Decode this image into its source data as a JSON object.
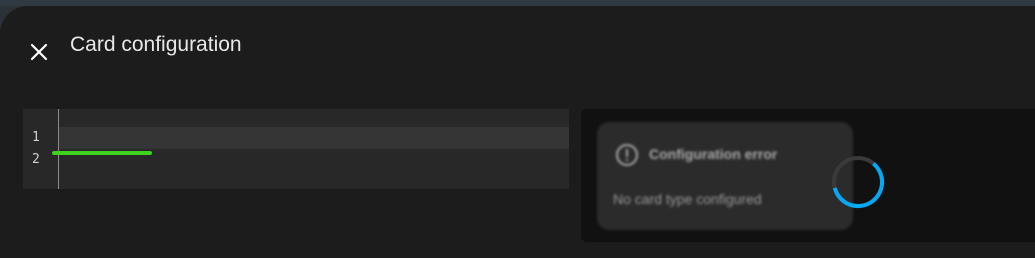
{
  "dialog": {
    "title": "Card configuration",
    "close_icon": "close-icon"
  },
  "editor": {
    "lines": [
      {
        "number": "1",
        "text": ""
      },
      {
        "number": "2",
        "text": ""
      }
    ]
  },
  "preview": {
    "error_card": {
      "icon": "alert-circle-icon",
      "title": "Configuration error",
      "message": "No card type configured"
    },
    "spinner": "loading-spinner"
  },
  "colors": {
    "dialog_bg": "#1c1c1c",
    "editor_bg": "#282828",
    "cursor_marker": "#3fd21e",
    "spinner_accent": "#03a9f4"
  }
}
